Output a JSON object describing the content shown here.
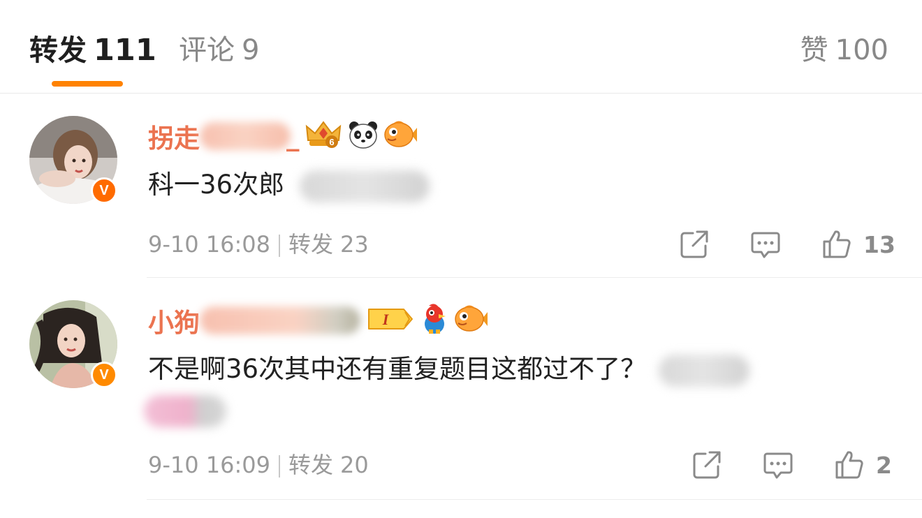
{
  "tabs": {
    "reposts": {
      "label": "转发",
      "count": "111"
    },
    "comments": {
      "label": "评论",
      "count": "9"
    },
    "likes": {
      "label": "赞",
      "count": "100"
    }
  },
  "colors": {
    "accent": "#ff8200",
    "username": "#eb7350",
    "meta": "#9a9a9a"
  },
  "comments": [
    {
      "username_prefix": "拐走",
      "username_suffix": "_",
      "badges": [
        "crown-level-6-badge",
        "panda-icon",
        "fish-icon"
      ],
      "badge_level": "6",
      "verified_icon": "v-badge",
      "text": "科一36次郎",
      "time": "9-10 16:08",
      "repost_label": "转发",
      "repost_count": "23",
      "like_count": "13"
    },
    {
      "username_prefix": "小狗",
      "badges": [
        "level-1-badge",
        "bird-icon",
        "fish-icon"
      ],
      "badge_level": "I",
      "verified_icon": "v-badge",
      "text": "不是啊36次其中还有重复题目这都过不了？",
      "time": "9-10 16:09",
      "repost_label": "转发",
      "repost_count": "20",
      "like_count": "2"
    }
  ]
}
